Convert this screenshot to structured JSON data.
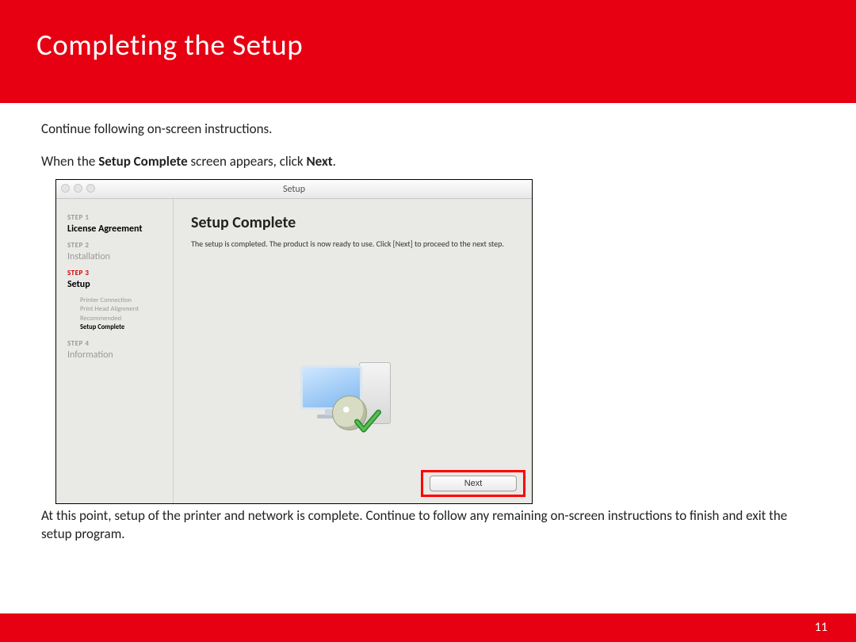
{
  "header": {
    "title": "Completing  the Setup"
  },
  "intro": {
    "line1": "Continue following on-screen instructions.",
    "line2_pre": "When the  ",
    "line2_bold1": "Setup Complete",
    "line2_mid": " screen appears, click ",
    "line2_bold2": "Next",
    "line2_post": "."
  },
  "window": {
    "title": "Setup",
    "sidebar": {
      "step1_label": "STEP 1",
      "step1_name": "License Agreement",
      "step2_label": "STEP 2",
      "step2_name": "Installation",
      "step3_label": "STEP 3",
      "step3_name": "Setup",
      "sub1": "Printer Connection",
      "sub2": "Print Head Alignment Recommended",
      "sub3": "Setup Complete",
      "step4_label": "STEP 4",
      "step4_name": "Information"
    },
    "main": {
      "heading": "Setup Complete",
      "desc": "The setup is completed. The product is now ready to use. Click [Next] to proceed to the next step."
    },
    "next_label": "Next"
  },
  "after": "At this point, setup of the printer and network is complete.  Continue to follow any remaining on-screen instructions to finish and exit the setup program.",
  "page_number": "11"
}
